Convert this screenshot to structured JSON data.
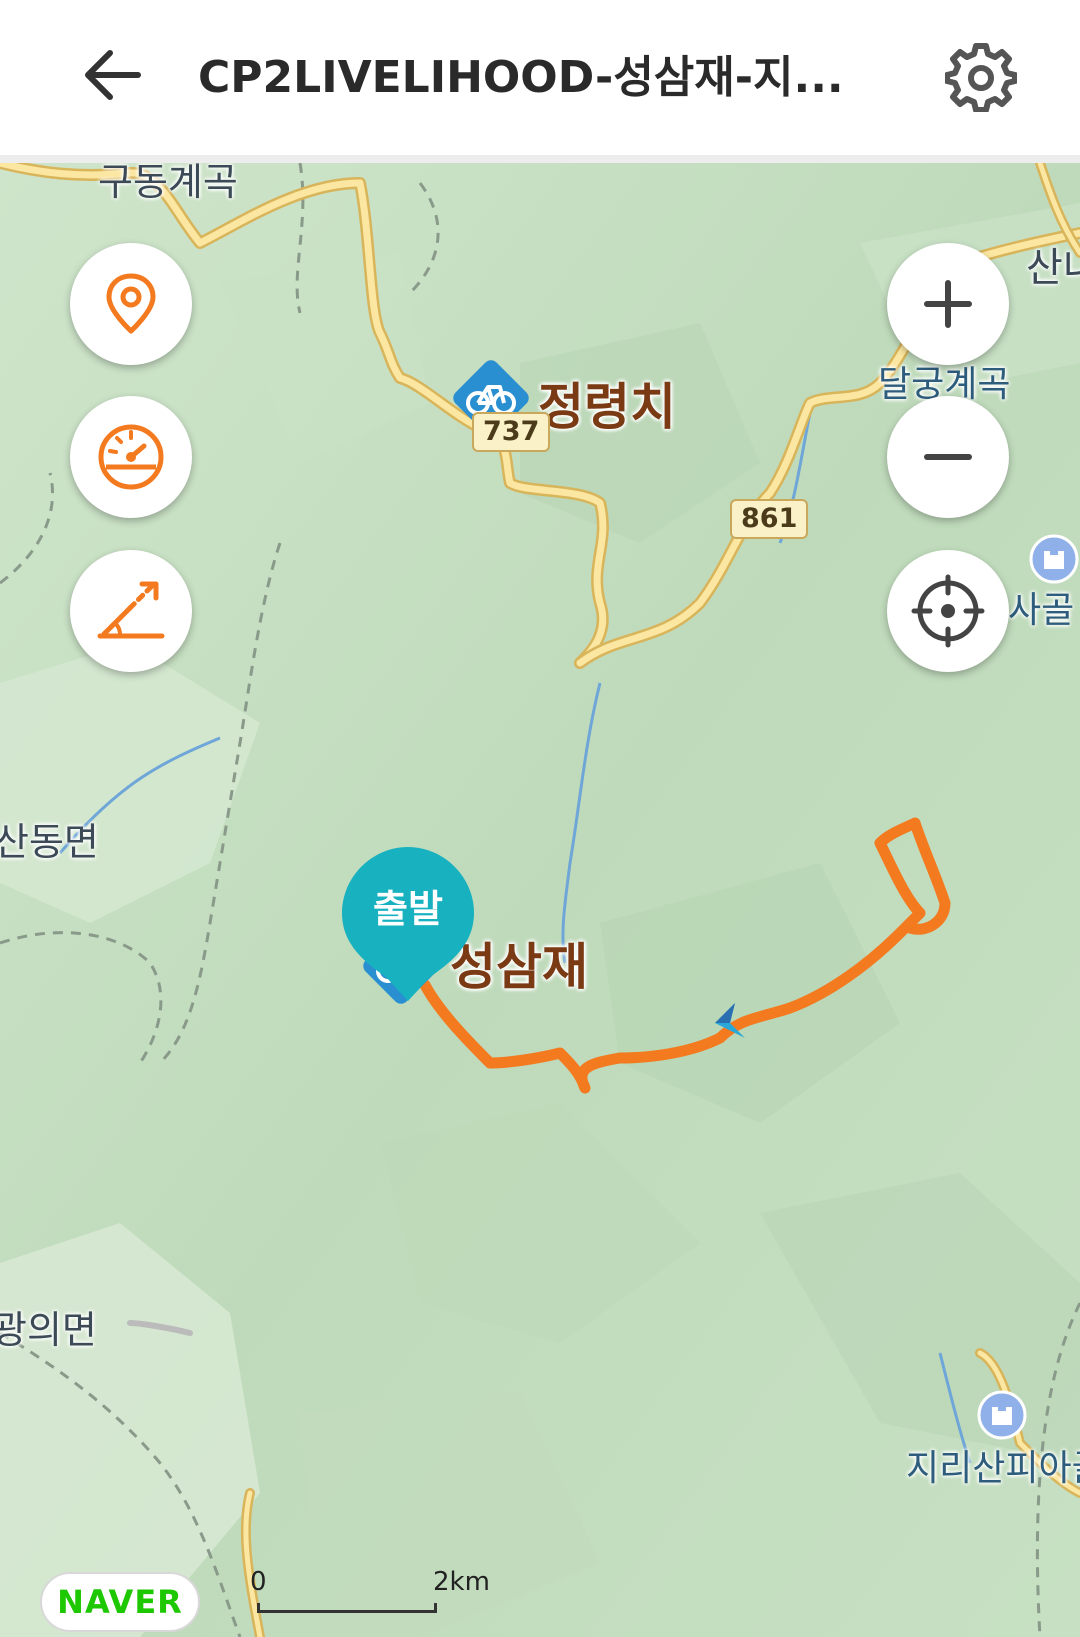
{
  "header": {
    "title": "CP2LIVELIHOOD-성삼재-지..."
  },
  "map": {
    "labels": {
      "pass_north": "정령치",
      "pass_start": "성삼재",
      "valley_top": "구동계곡",
      "valley_right": "달궁계곡",
      "right_edge_top": "산내",
      "dong_area": "산동면",
      "gwangui_area": "광의면",
      "sagol": "사골",
      "piagol": "지리산피아골"
    },
    "road_numbers": {
      "r737": "737",
      "r861": "861"
    },
    "start_marker": "출발",
    "route_color": "#f47a20",
    "brand": "NAVER",
    "scale": {
      "zero": "0",
      "max": "2km"
    }
  },
  "controls": {
    "left": [
      "location-pin-icon",
      "speedometer-icon",
      "slope-icon"
    ],
    "right": [
      "zoom-in-icon",
      "zoom-out-icon",
      "crosshair-icon"
    ]
  },
  "colors": {
    "accent": "#f47a20",
    "start_pin": "#17b1bf",
    "bike_poi": "#2a8fd0"
  }
}
